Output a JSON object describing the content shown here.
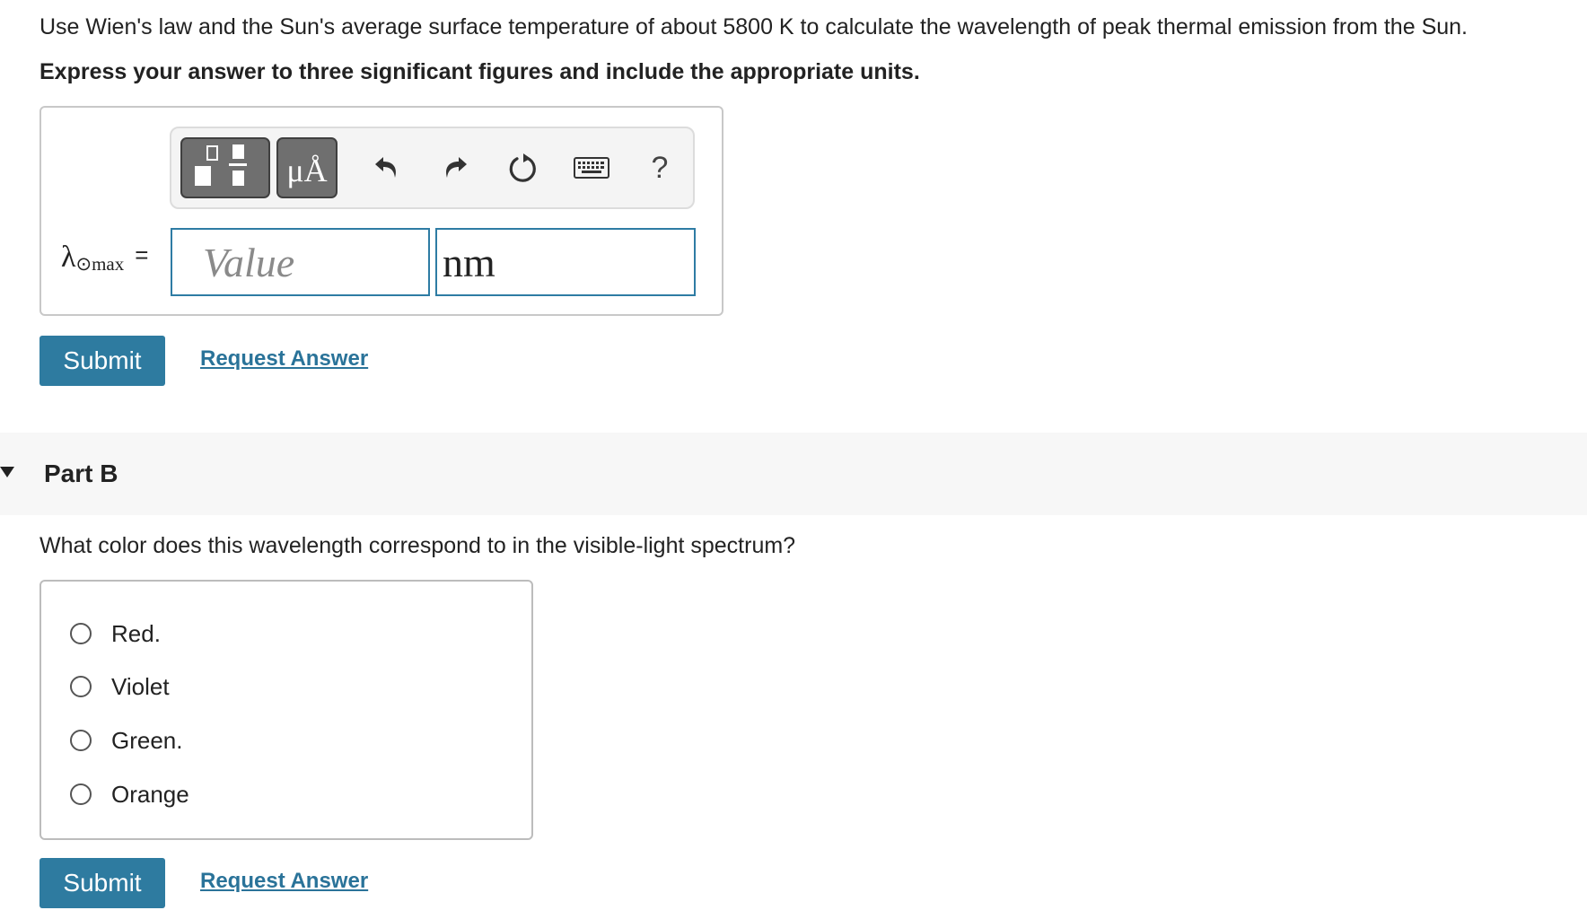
{
  "part_a": {
    "question": "Use Wien's law and the Sun's average surface temperature of about 5800 K to calculate the wavelength of peak thermal emission from the Sun.",
    "instruction": "Express your answer to three significant figures and include the appropriate units.",
    "toolbar": {
      "units_glyph": "μÅ",
      "help_glyph": "?"
    },
    "variable": {
      "symbol": "λ",
      "subscript": "⊙max",
      "equals": "="
    },
    "value_input": {
      "value": "",
      "placeholder": "Value"
    },
    "unit_input": {
      "value": "nm",
      "placeholder": ""
    },
    "submit_label": "Submit",
    "request_label": "Request Answer"
  },
  "part_b": {
    "title": "Part B",
    "question": "What color does this wavelength correspond to in the visible-light spectrum?",
    "options": [
      {
        "label": "Red."
      },
      {
        "label": "Violet"
      },
      {
        "label": "Green."
      },
      {
        "label": "Orange"
      }
    ],
    "submit_label": "Submit",
    "request_label": "Request Answer"
  },
  "colors": {
    "accent": "#2e7ba0",
    "link": "#2a7399",
    "input_border": "#2e7ca4",
    "toolbar_button": "#6f6f6f"
  },
  "icons": {
    "templates": "fraction-template-icon",
    "undo": "undo-icon",
    "redo": "redo-icon",
    "reset": "reset-icon",
    "keyboard": "keyboard-icon",
    "help": "help-icon"
  }
}
